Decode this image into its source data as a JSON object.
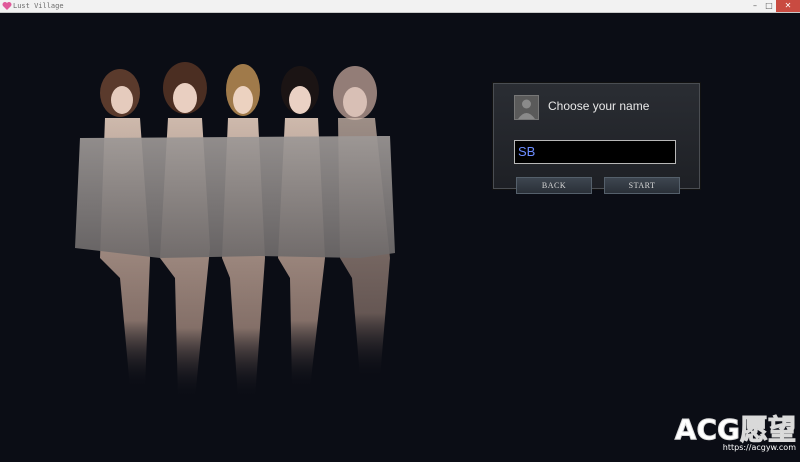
{
  "window": {
    "title": "Lust Village",
    "icon": "heart-app-icon",
    "controls": {
      "minimize": "–",
      "maximize": "□",
      "close": "✕"
    }
  },
  "dialog": {
    "title": "Choose your name",
    "avatar_icon": "person-silhouette-icon",
    "name_value": "SB",
    "back_label": "BACK",
    "start_label": "START"
  },
  "watermark": {
    "logo": "ACG愿望",
    "url": "https://acgyw.com"
  },
  "colors": {
    "background": "#0b0d15",
    "input_text": "#6c8cff",
    "dialog_bg": "#25282d"
  }
}
